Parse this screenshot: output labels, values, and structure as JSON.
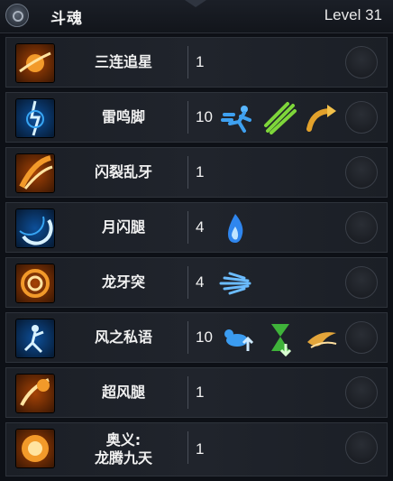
{
  "header": {
    "title": "斗魂",
    "level": "Level 31"
  },
  "skills": [
    {
      "name": "三连追星",
      "level": "1",
      "icon": "triple-star-chase-icon",
      "color": "#e6861c",
      "runes": []
    },
    {
      "name": "雷鸣脚",
      "level": "10",
      "icon": "thunder-kick-icon",
      "color": "#2b8fe0",
      "runes": [
        "sprint-rune-icon",
        "triple-slash-rune-icon",
        "curved-arrow-rune-icon"
      ]
    },
    {
      "name": "闪裂乱牙",
      "level": "1",
      "icon": "flash-rend-icon",
      "color": "#e5761a",
      "runes": []
    },
    {
      "name": "月闪腿",
      "level": "4",
      "icon": "moon-flash-kick-icon",
      "color": "#3aa6ee",
      "runes": [
        "blue-flame-rune-icon"
      ]
    },
    {
      "name": "龙牙突",
      "level": "4",
      "icon": "dragon-fang-thrust-icon",
      "color": "#e7781e",
      "runes": [
        "dash-streak-rune-icon"
      ]
    },
    {
      "name": "风之私语",
      "level": "10",
      "icon": "wind-whisper-icon",
      "color": "#2f8fe2",
      "runes": [
        "pet-up-rune-icon",
        "hourglass-down-rune-icon",
        "wind-swirl-rune-icon"
      ]
    },
    {
      "name": "超风腿",
      "level": "1",
      "icon": "super-wind-kick-icon",
      "color": "#e8831f",
      "runes": []
    },
    {
      "name": "奥义:\n龙腾九天",
      "level": "1",
      "icon": "dragon-soar-ultimate-icon",
      "color": "#e06a17",
      "runes": []
    }
  ]
}
